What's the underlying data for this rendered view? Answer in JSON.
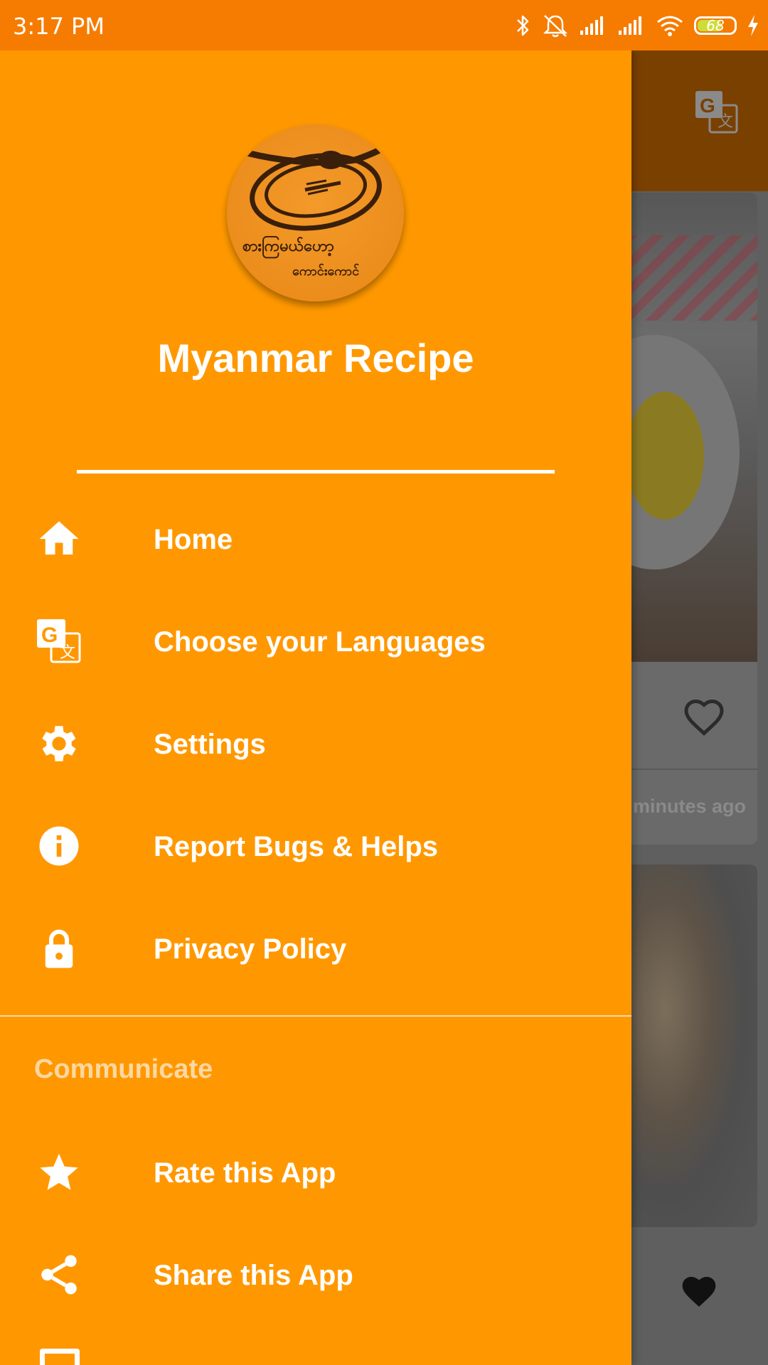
{
  "status_bar": {
    "time": "3:17 PM",
    "battery": "68",
    "battery_level": 0.68
  },
  "drawer": {
    "app_title": "Myanmar Recipe",
    "logo_text_top": "စားကြမယ်ဟော့",
    "logo_text_bottom": "ကောင်းကောင်",
    "menu": [
      {
        "label": "Home",
        "icon": "home-icon"
      },
      {
        "label": "Choose your Languages",
        "icon": "translate-icon"
      },
      {
        "label": "Settings",
        "icon": "gear-icon"
      },
      {
        "label": "Report Bugs & Helps",
        "icon": "info-icon"
      },
      {
        "label": "Privacy Policy",
        "icon": "lock-icon"
      }
    ],
    "section_title": "Communicate",
    "communicate_menu": [
      {
        "label": "Rate this App",
        "icon": "star-icon"
      },
      {
        "label": "Share this App",
        "icon": "share-icon"
      }
    ]
  },
  "background": {
    "card_time_partial": "minutes ago"
  },
  "colors": {
    "drawer": "#ff9800",
    "status_bar": "#f57c00",
    "text": "#ffffff",
    "section_title": "#ffd8a0"
  }
}
